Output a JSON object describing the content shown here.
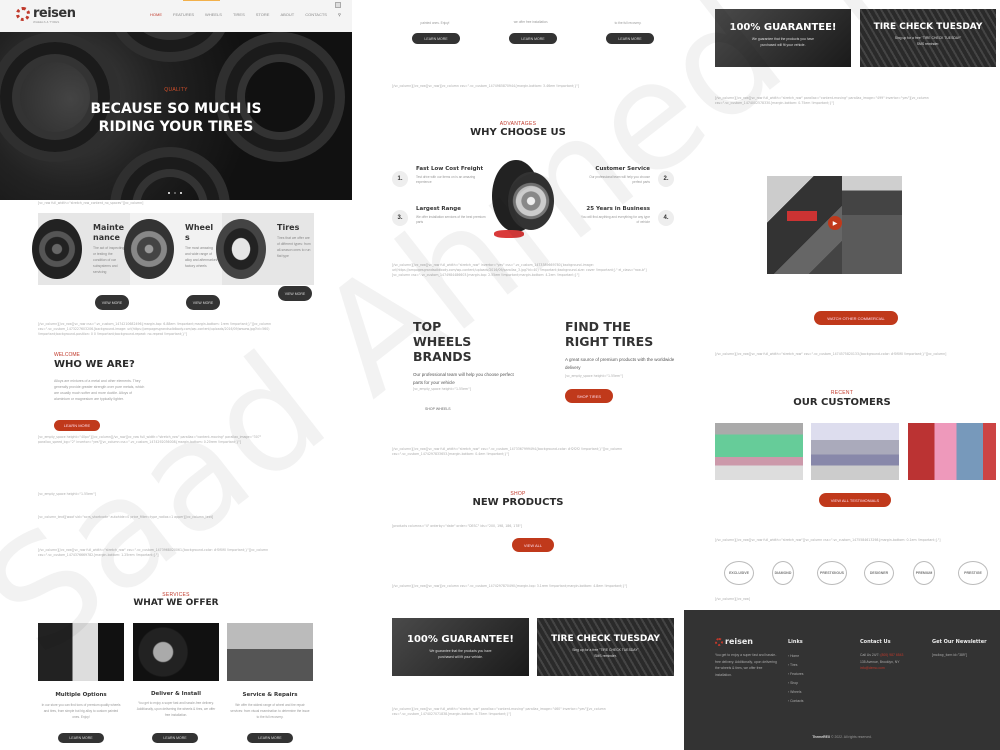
{
  "header": {
    "logo": "reisen",
    "logo_sub": "WHEELS & TYRES",
    "nav": [
      "HOME",
      "FEATURES",
      "WHEELS",
      "TIRES",
      "STORE",
      "ABOUT",
      "CONTACTS"
    ],
    "active_nav": "HOME"
  },
  "hero": {
    "kicker": "QUALITY",
    "title_line1": "BECAUSE SO MUCH IS",
    "title_line2": "RIDING YOUR TIRES",
    "slides": 3
  },
  "shortcodes": {
    "s1": "[vc_row full_width=\"stretch_row_content_no_spaces\"][vc_column]",
    "s2": "[/vc_column][/vc_row][vc_row css=\".vc_custom_1474210682496{margin-top: 6.88em !important;margin-bottom: 1rem !important;}\"][vc_column css=\".vc_custom_1473227603206{background-image: url(https://ampagesgrandsolidbody.com/wp-content/uploads/2016/09/wwww.jpg?id=560) !important;background-position: 0 0 !important;background-repeat: no-repeat !important;}\"]",
    "s3": "[vc_empty_space height=\"40px\"][/vc_column][/vc_row][vc_row full_width=\"stretch_row\" parallax=\"content-moving\" parallax_image=\"307\" parallax_speed_bg=\"2\" invertor=\"yes\"][vc_column css=\".vc_custom_1474292036008{margin-bottom: 0.20rem !important;}\"]",
    "s4": "[vc_empty_space height=\"1.55em\"]",
    "s5": "[vc_column_text][woof sid=\"acrs_shortcode\" autohide=0 price_filter=type_radios=1 apper][/vc_column_text]",
    "s6": "[/vc_column][/vc_row][vc_row full_width=\"stretch_row\" css=\".vc_custom_1473968020061{background-color: #f0f0f0 !important;}\"][vc_column css=\".vc_custom_1474376669782{margin-bottom: 1.25rem !important;}\"]",
    "s7": "[/vc_column][/vc_row][vc_row][vc_column css=\".vc_custom_1474985870944{margin-bottom: 3.46em !important;}\"]",
    "s8": "[/vc_column][/vc_row][vc_row full_width=\"stretch_row\" invertor=\"yes\" css=\".vc_custom_1473389669780{background-image: url(https://ampagesgrandsolidbody.com/wp-content/uploads/2016/09/parallax_3.jpg?id=40) !important;background-size: cover !important;}\" el_class=\"row-b\"][vc_column css=\".vc_custom_1474984486603{margin-top: 2.55em !important;margin-bottom: 4.2em !important;}\"]",
    "s9": "[/vc_column][/vc_row][vc_row full_width=\"stretch_row\" css=\".vc_custom_1473367999494{background-color: #f2f2f2 !important;}\"][vc_column css=\".vc_custom_1474297833653{margin-bottom: 0.4em !important;}\"]",
    "s10": "[products columns=\"4\" orderby=\"date\" order=\"DESC\" ids=\"200, 198, 186, 178\"]",
    "s11": "[/vc_column][/vc_row][vc_row][vc_column css=\".vc_custom_1474297870490{margin-top: 3.1rem !important;margin-bottom: 4.8em !important;}\"]",
    "s12": "[/vc_column][/vc_row][vc_row full_width=\"stretch_row\" parallax=\"content-moving\" parallax_image=\"460\" invertor=\"yes\"][vc_column css=\".vc_custom_1474027071838{margin-bottom: 0.75em !important;}\"]",
    "s13": "[/vc_column][/vc_row][vc_row full_width=\"stretch_row\" parallax=\"content-moving\" parallax_image=\"499\" invertor=\"yes\"][vc_column css=\".vc_custom_1474002578330{margin-bottom: 0.75em !important;}\"]",
    "s14": "[/vc_column][/vc_row][vc_row full_width=\"stretch_row\" css=\".vc_custom_1474575820133{background-color: #f0f0f0 !important;}\"][vc_column]",
    "s15": "[/vc_column][/vc_row][vc_row full_width=\"stretch_row\"][vc_column css=\".vc_custom_1475584613298{margin-bottom: 0.1em !important;}\"]",
    "s16": "[/vc_column][/vc_row]",
    "empty1": "[vc_empty_space height=\"1.55em\"]",
    "empty2": "[vc_empty_space height=\"1.55em\"]"
  },
  "features": [
    {
      "title": "Maintenance",
      "title_l1": "Mainte",
      "title_l2": "nance",
      "text": "The act of inspecting or testing the condition of car subsystems and servicing",
      "button": "VIEW MORE"
    },
    {
      "title": "Wheels",
      "title_l1": "Wheel",
      "title_l2": "s",
      "text": "The most amazing and wide range of alloy and aftermarket/ factory wheels",
      "button": "VIEW MORE"
    },
    {
      "title": "Tires",
      "title_l1": "Tires",
      "title_l2": "",
      "text": "Tires that we offer are of different types: from all-season ones to run flat type",
      "button": "VIEW MORE"
    }
  ],
  "welcome": {
    "kicker": "WELCOME",
    "title": "WHO WE ARE?",
    "text": "Alloys are mixtures of a metal and other elements. They generally provide greater strength over pure metals, which are usually much softer and more ductile. Alloys of aluminium or magnesium are typically lighter.",
    "button": "LEARN MORE"
  },
  "services": {
    "kicker": "SERVICES",
    "title": "WHAT WE OFFER",
    "items": [
      {
        "title": "Multiple Options",
        "text": "In our store you can find tons of premium quality wheels and tires, from simple but big alloy to custom painted ones. Enjoy!",
        "button": "LEARN MORE"
      },
      {
        "title": "Deliver & Install",
        "text": "You get to enjoy a super fast and hassle-free delivery. Additionally, upon delivering the wheels & tires, we offer free installation.",
        "button": "LEARN MORE"
      },
      {
        "title": "Service & Repairs",
        "text": "We offer the widest range of wheel and tire repair services: from visual examination to determine the issue to the full recovery.",
        "button": "LEARN MORE"
      }
    ],
    "col2_continued": [
      "painted ones. Enjoy!",
      "we offer free installation.",
      "to the full recovery."
    ]
  },
  "advantages": {
    "kicker": "ADVANTAGES",
    "title": "WHY CHOOSE US",
    "items": [
      {
        "num": "1.",
        "title": "Fast Low Cost Freight",
        "text": "Test drive with our items on is an amazing experience"
      },
      {
        "num": "2.",
        "title": "Customer Service",
        "text": "Our professional team will help you choose perfect parts"
      },
      {
        "num": "3.",
        "title": "Largest Range",
        "text": "We offer installation services of the best premium parts"
      },
      {
        "num": "4.",
        "title": "25 Years in Business",
        "text": "You will find anything and everything for any type of vehicle"
      }
    ]
  },
  "brands_promo": {
    "left_title_l1": "TOP",
    "left_title_l2": "WHEELS",
    "left_title_l3": "BRANDS",
    "left_text": "Our professional team will help you choose perfect parts for your vehicle",
    "left_sc": "[vc_empty_space height=\"1.55em\"]",
    "left_button": "SHOP WHEELS",
    "right_title_l1": "FIND THE",
    "right_title_l2": "RIGHT TIRES",
    "right_text": "A great source of premium products with the worldwide delivery",
    "right_sc": "[vc_empty_space height=\"1.55em\"]",
    "right_button": "SHOP TIRES"
  },
  "shop": {
    "kicker": "SHOP",
    "title": "NEW PRODUCTS",
    "button": "VIEW ALL"
  },
  "promos": [
    {
      "title": "100% GUARANTEE!",
      "text_l1": "We guarantee that the products you have",
      "text_l2": "purchased will fit your vehicle."
    },
    {
      "title": "TIRE CHECK TUESDAY",
      "text_l1": "Sing up for a free \"TIRE CHECK TUESDAY\"",
      "text_l2": "SMS reminder."
    }
  ],
  "video": {
    "button": "WATCH OTHER COMMERCIAL"
  },
  "customers": {
    "kicker": "RECENT",
    "title": "OUR CUSTOMERS",
    "button": "VIEW ALL TESTIMONIALS",
    "brands": [
      "EXCLUSIVE",
      "DIAMOND",
      "PRESTIGIOUS",
      "DESIGNER",
      "PREMIUM",
      "PRESTIGE"
    ]
  },
  "footer": {
    "logo": "reisen",
    "about": "You get to enjoy a super fast and hassle-free delivery. Additionally, upon delivering the wheels & tires, we offer free installation.",
    "links_title": "Links",
    "links": [
      "Home",
      "Tires",
      "Features",
      "Shop",
      "Wheels",
      "Contacts"
    ],
    "contact_title": "Contact Us",
    "contact_call": "Call Us 24/7:",
    "contact_phone": "(800) 987 6543",
    "contact_address": "135 Avenue, Brooklyn, NY",
    "contact_email": "info@demo.com",
    "newsletter_title": "Get Our Newsletter",
    "newsletter_sc": "[mc4wp_form id=\"389\"]",
    "copyright_brand": "ThemeREX",
    "copyright": "© 2022. All rights reserved."
  },
  "colors": {
    "accent": "#c0391b",
    "dark": "#333333",
    "footer_bg": "#333333"
  }
}
